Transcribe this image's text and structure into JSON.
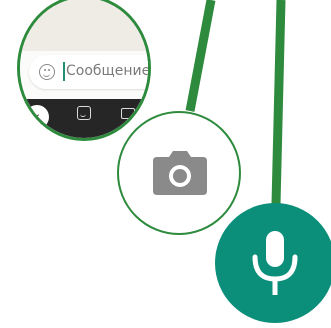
{
  "colors": {
    "line": "#2e8b3d",
    "accent": "#0b8f7a",
    "icon_gray": "#8a8a8a"
  },
  "composer": {
    "placeholder": "Сообщение",
    "emoji_icon": "emoji-icon",
    "back_icon": "chevron-left-icon",
    "back_label": "‹",
    "sticker_icon": "sticker-icon",
    "gif_icon": "gif-icon"
  },
  "camera_button": {
    "icon": "camera-icon"
  },
  "mic_button": {
    "icon": "microphone-icon"
  }
}
